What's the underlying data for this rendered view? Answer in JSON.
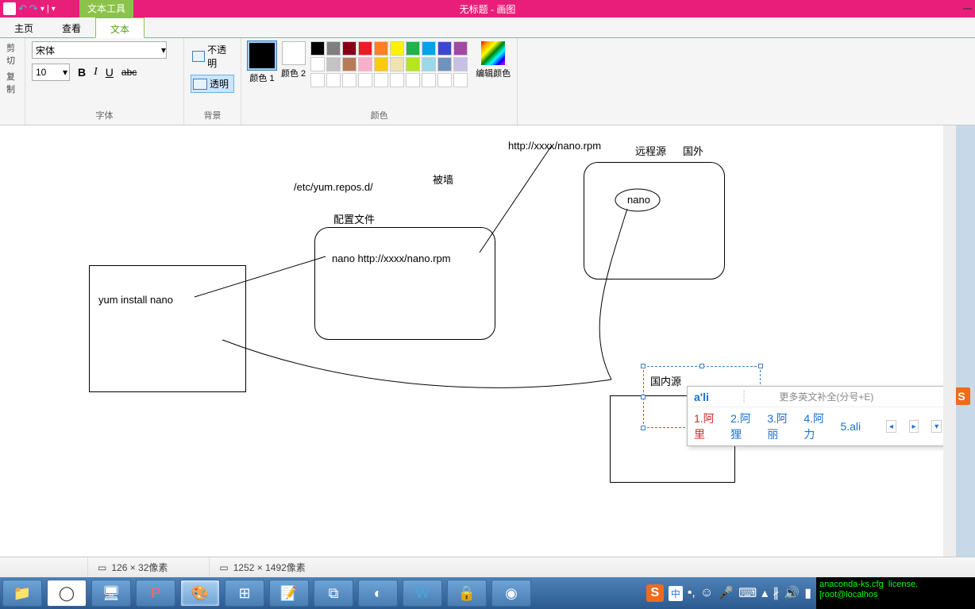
{
  "titlebar": {
    "context_tab": "文本工具",
    "title": "无标题 - 画图"
  },
  "tabs": {
    "home": "主页",
    "view": "查看",
    "text": "文本"
  },
  "ribbon": {
    "clipboard": {
      "cut": "剪切",
      "copy": "复制"
    },
    "font": {
      "family": "宋体",
      "size": "10",
      "bold": "B",
      "italic": "I",
      "underline": "U",
      "strike": "abc",
      "label": "字体"
    },
    "background": {
      "opaque": "不透明",
      "transparent": "透明",
      "label": "背景"
    },
    "colors": {
      "color1_label": "颜色 1",
      "color2_label": "颜色 2",
      "edit_label": "编辑颜色",
      "label": "颜色",
      "row1": [
        "#000000",
        "#7f7f7f",
        "#880015",
        "#ed1c24",
        "#ff7f27",
        "#fff200",
        "#22b14c",
        "#00a2e8",
        "#3f48cc",
        "#a349a4"
      ],
      "row2": [
        "#ffffff",
        "#c3c3c3",
        "#b97a57",
        "#ffaec9",
        "#ffc90e",
        "#efe4b0",
        "#b5e61d",
        "#99d9ea",
        "#7092be",
        "#c8bfe7"
      ],
      "row3": [
        "#ffffff",
        "#ffffff",
        "#ffffff",
        "#ffffff",
        "#ffffff",
        "#ffffff",
        "#ffffff",
        "#ffffff",
        "#ffffff",
        "#ffffff"
      ]
    }
  },
  "canvas": {
    "url_label": "http://xxxx/nano.rpm",
    "remote_src": "远程源",
    "foreign": "国外",
    "wall": "被墙",
    "repos_path": "/etc/yum.repos.d/",
    "config_label": "配置文件",
    "box2_text": "nano  http://xxxx/nano.rpm",
    "nano_label": "nano",
    "box1_text": "yum install nano",
    "domestic_src": "国内源"
  },
  "ime": {
    "input": "a'li",
    "hint": "更多英文补全(分号+E)",
    "candidates": [
      "1.阿里",
      "2.阿狸",
      "3.阿丽",
      "4.阿力",
      "5.ali"
    ]
  },
  "statusbar": {
    "selection": "126 × 32像素",
    "canvas_size": "1252 × 1492像素"
  },
  "taskbar": {
    "terminal_line1": "anaconda-ks.cfg  license.",
    "terminal_line2": "[root@localhos",
    "zhong": "中"
  }
}
